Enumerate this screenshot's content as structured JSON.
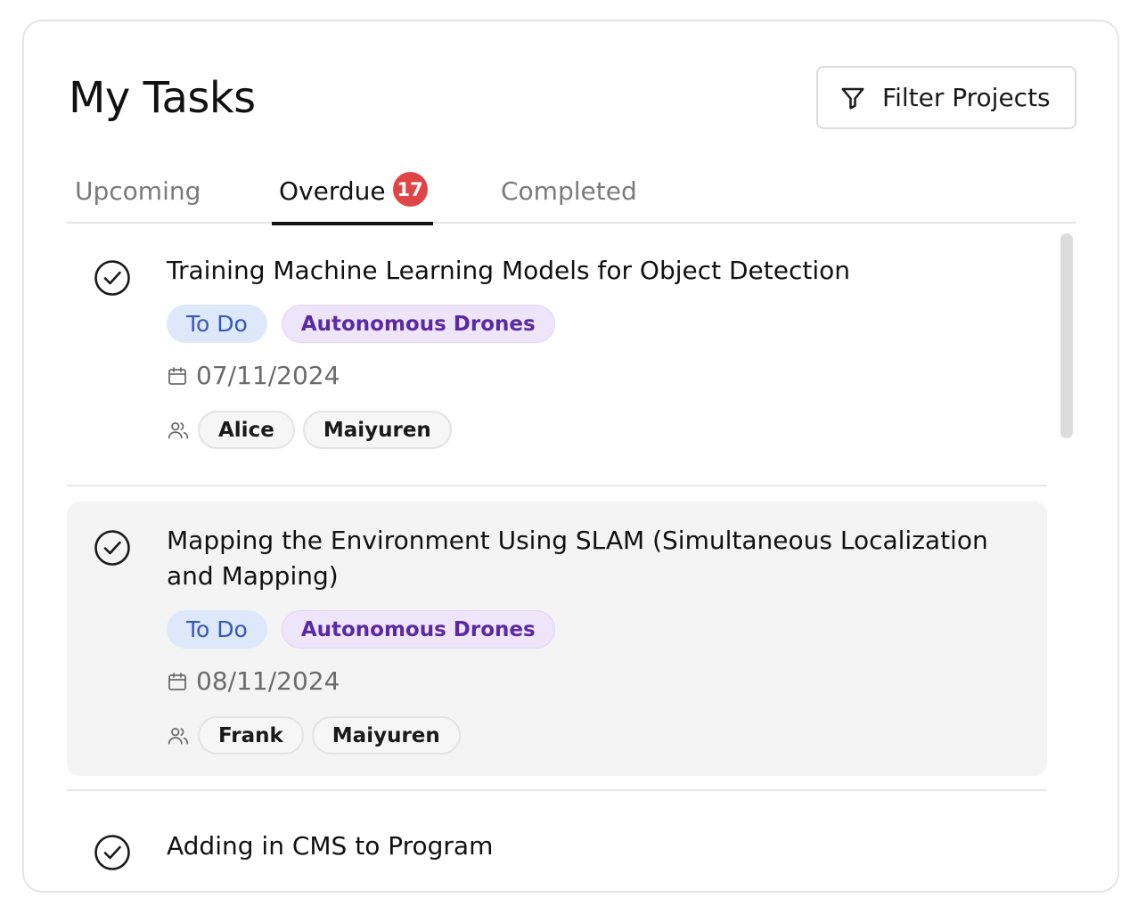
{
  "header": {
    "title": "My Tasks",
    "filter_label": "Filter Projects"
  },
  "tabs": [
    {
      "label": "Upcoming",
      "active": false
    },
    {
      "label": "Overdue",
      "active": true,
      "badge": "17"
    },
    {
      "label": "Completed",
      "active": false
    }
  ],
  "tasks": [
    {
      "title": "Training Machine Learning Models for Object Detection",
      "status": "To Do",
      "project": "Autonomous Drones",
      "date": "07/11/2024",
      "assignees": [
        "Alice",
        "Maiyuren"
      ]
    },
    {
      "title": "Mapping the Environment Using SLAM (Simultaneous Localization and Mapping)",
      "status": "To Do",
      "project": "Autonomous Drones",
      "date": "08/11/2024",
      "assignees": [
        "Frank",
        "Maiyuren"
      ]
    },
    {
      "title": "Adding in CMS to Program"
    }
  ],
  "colors": {
    "badge": "#e04545",
    "status_chip_bg": "#dde8fa",
    "status_chip_text": "#3858b8",
    "project_chip_bg": "#efe5fb",
    "project_chip_text": "#5b2aa0",
    "highlight_row": "#f4f4f4"
  }
}
